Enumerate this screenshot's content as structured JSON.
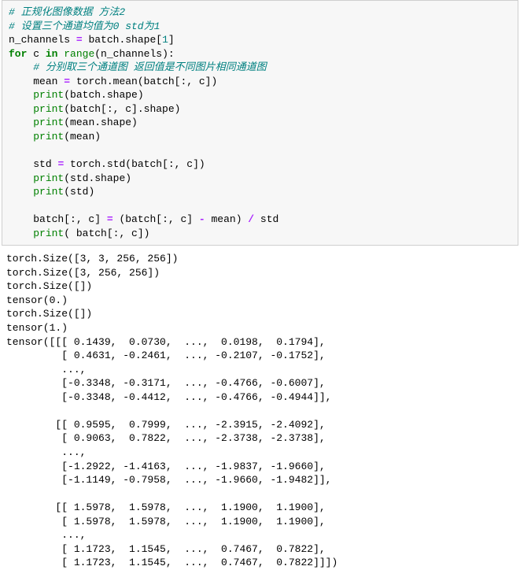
{
  "code": {
    "line1": "# 正规化图像数据 方法2",
    "line2": "# 设置三个通道均值为0 std为1",
    "l3_a": "n_channels ",
    "l3_b": " batch.shape[",
    "l3_num": "1",
    "l3_c": "]",
    "l4_for": "for",
    "l4_c": " c ",
    "l4_in": "in",
    "l4_sp": " ",
    "l4_range": "range",
    "l4_call": "(n_channels):",
    "l5_indent": "    ",
    "l5_comment": "# 分别取三个通道图 返回值是不同图片相同通道图",
    "l6_indent": "    ",
    "l6_a": "mean ",
    "l6_b": " torch.mean(batch[:, c])",
    "l7_indent": "    ",
    "l7_print": "print",
    "l7_arg": "(batch.shape)",
    "l8_indent": "    ",
    "l8_print": "print",
    "l8_arg": "(batch[:, c].shape)",
    "l9_indent": "    ",
    "l9_print": "print",
    "l9_arg": "(mean.shape)",
    "l10_indent": "    ",
    "l10_print": "print",
    "l10_arg": "(mean)",
    "l12_indent": "    ",
    "l12_a": "std ",
    "l12_b": " torch.std(batch[:, c])",
    "l13_indent": "    ",
    "l13_print": "print",
    "l13_arg": "(std.shape)",
    "l14_indent": "    ",
    "l14_print": "print",
    "l14_arg": "(std)",
    "l16_indent": "    ",
    "l16_a": "batch[:, c] ",
    "l16_b": " (batch[:, c] ",
    "l16_c": " mean) ",
    "l16_d": " std",
    "l17_indent": "    ",
    "l17_print": "print",
    "l17_arg": "( batch[:, c])",
    "eq": "=",
    "minus": "-",
    "div": "/"
  },
  "output": {
    "o1": "torch.Size([3, 3, 256, 256])",
    "o2": "torch.Size([3, 256, 256])",
    "o3": "torch.Size([])",
    "o4": "tensor(0.)",
    "o5": "torch.Size([])",
    "o6": "tensor(1.)",
    "o7": "tensor([[[ 0.1439,  0.0730,  ...,  0.0198,  0.1794],",
    "o8": "         [ 0.4631, -0.2461,  ..., -0.2107, -0.1752],",
    "o9": "         ...,",
    "o10": "         [-0.3348, -0.3171,  ..., -0.4766, -0.6007],",
    "o11": "         [-0.3348, -0.4412,  ..., -0.4766, -0.4944]],",
    "o12": "",
    "o13": "        [[ 0.9595,  0.7999,  ..., -2.3915, -2.4092],",
    "o14": "         [ 0.9063,  0.7822,  ..., -2.3738, -2.3738],",
    "o15": "         ...,",
    "o16": "         [-1.2922, -1.4163,  ..., -1.9837, -1.9660],",
    "o17": "         [-1.1149, -0.7958,  ..., -1.9660, -1.9482]],",
    "o18": "",
    "o19": "        [[ 1.5978,  1.5978,  ...,  1.1900,  1.1900],",
    "o20": "         [ 1.5978,  1.5978,  ...,  1.1900,  1.1900],",
    "o21": "         ...,",
    "o22": "         [ 1.1723,  1.1545,  ...,  0.7467,  0.7822],",
    "o23": "         [ 1.1723,  1.1545,  ...,  0.7467,  0.7822]]])"
  }
}
